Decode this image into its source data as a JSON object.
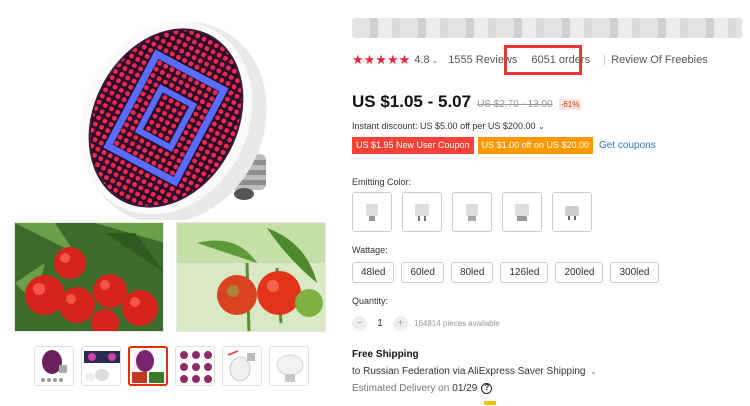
{
  "gallery": {
    "main_image": "led-grow-bulb",
    "thumbnails": [
      "bulb-purple",
      "lamp-set",
      "bulb-with-plants",
      "led-boards",
      "bulb-angle",
      "bulb-white"
    ],
    "active_thumbnail": 2
  },
  "product": {
    "rating": "4.8",
    "reviews": "1555 Reviews",
    "orders": "6051 orders",
    "review_freebies": "Review Of Freebies",
    "price": "US $1.05 - 5.07",
    "old_price": "US $2.70 - 13.00",
    "discount": "-61%",
    "instant_discount": "Instant discount: US $5.00 off per US $200.00",
    "coupons": [
      "US $1.95 New User Coupon",
      "US $1.00 off on US $20.00"
    ],
    "get_coupons": "Get coupons"
  },
  "options": {
    "color_label": "Emitting Color:",
    "color_count": 5,
    "wattage_label": "Wattage:",
    "wattages": [
      "48led",
      "60led",
      "80led",
      "126led",
      "200led",
      "300led"
    ],
    "quantity_label": "Quantity:",
    "quantity": "1",
    "available": "164814 pieces available"
  },
  "shipping": {
    "title": "Free Shipping",
    "to": "to Russian Federation via AliExpress Saver Shipping",
    "estimated_label": "Estimated Delivery on",
    "date": "01/29"
  },
  "colors": {
    "star": "#f5233c",
    "highlight": "#e53935",
    "coupon_red": "#f44336",
    "coupon_orange": "#ff9800",
    "link": "#2a7ebd"
  }
}
